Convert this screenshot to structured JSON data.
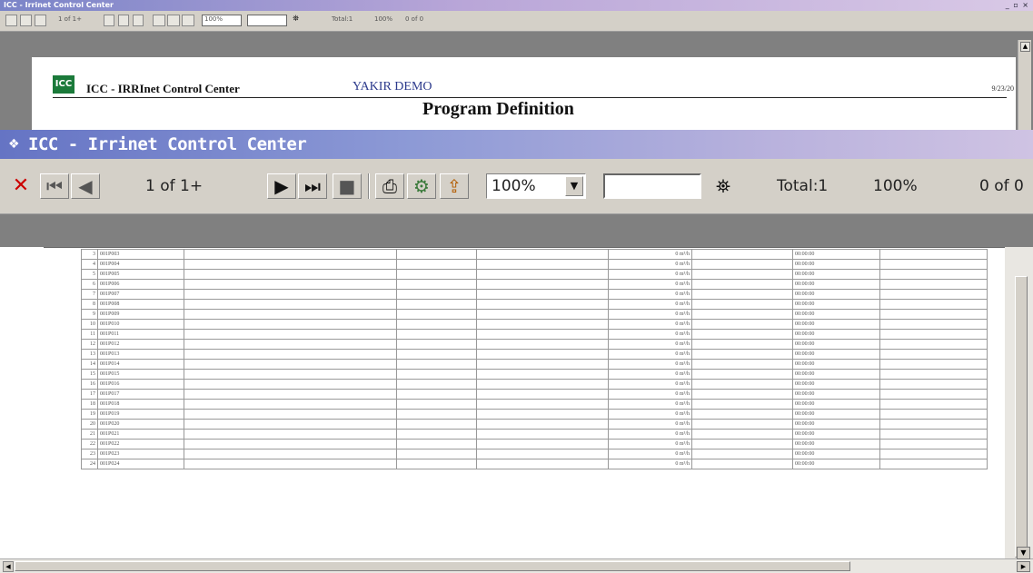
{
  "background_window": {
    "title": "ICC - Irrinet Control Center",
    "window_buttons": "_ ▫ ×",
    "toolbar": {
      "page_indicator": "1 of 1+",
      "zoom": "100%",
      "total": "Total:1",
      "percent": "100%",
      "found": "0 of 0"
    },
    "report": {
      "logo": "ICC",
      "app_title": "ICC - IRRInet Control Center",
      "customer": "YAKIR DEMO",
      "date": "9/23/20",
      "title": "Program Definition"
    }
  },
  "window": {
    "title": "ICC - Irrinet Control Center"
  },
  "toolbar": {
    "page_indicator": "1 of 1+",
    "zoom": "100%",
    "search_value": "",
    "total": "Total:1",
    "percent": "100%",
    "found": "0 of 0",
    "icons": [
      "close-icon",
      "first-page-icon",
      "prev-page-icon",
      "next-page-icon",
      "last-page-icon",
      "stop-icon",
      "print-icon",
      "printer-setup-icon",
      "export-icon",
      "zoom-dropdown-icon",
      "binoculars-icon"
    ]
  },
  "table": {
    "rows": [
      {
        "num": "3",
        "id": "001P003",
        "rate": "0 m³/h",
        "time": "00:00:00"
      },
      {
        "num": "4",
        "id": "001P004",
        "rate": "0 m³/h",
        "time": "00:00:00"
      },
      {
        "num": "5",
        "id": "001P005",
        "rate": "0 m³/h",
        "time": "00:00:00"
      },
      {
        "num": "6",
        "id": "001P006",
        "rate": "0 m³/h",
        "time": "00:00:00"
      },
      {
        "num": "7",
        "id": "001P007",
        "rate": "0 m³/h",
        "time": "00:00:00"
      },
      {
        "num": "8",
        "id": "001P008",
        "rate": "0 m³/h",
        "time": "00:00:00"
      },
      {
        "num": "9",
        "id": "001P009",
        "rate": "0 m³/h",
        "time": "00:00:00"
      },
      {
        "num": "10",
        "id": "001P010",
        "rate": "0 m³/h",
        "time": "00:00:00"
      },
      {
        "num": "11",
        "id": "001P011",
        "rate": "0 m³/h",
        "time": "00:00:00"
      },
      {
        "num": "12",
        "id": "001P012",
        "rate": "0 m³/h",
        "time": "00:00:00"
      },
      {
        "num": "13",
        "id": "001P013",
        "rate": "0 m³/h",
        "time": "00:00:00"
      },
      {
        "num": "14",
        "id": "001P014",
        "rate": "0 m³/h",
        "time": "00:00:00"
      },
      {
        "num": "15",
        "id": "001P015",
        "rate": "0 m³/h",
        "time": "00:00:00"
      },
      {
        "num": "16",
        "id": "001P016",
        "rate": "0 m³/h",
        "time": "00:00:00"
      },
      {
        "num": "17",
        "id": "001P017",
        "rate": "0 m³/h",
        "time": "00:00:00"
      },
      {
        "num": "18",
        "id": "001P018",
        "rate": "0 m³/h",
        "time": "00:00:00"
      },
      {
        "num": "19",
        "id": "001P019",
        "rate": "0 m³/h",
        "time": "00:00:00"
      },
      {
        "num": "20",
        "id": "001P020",
        "rate": "0 m³/h",
        "time": "00:00:00"
      },
      {
        "num": "21",
        "id": "001P021",
        "rate": "0 m³/h",
        "time": "00:00:00"
      },
      {
        "num": "22",
        "id": "001P022",
        "rate": "0 m³/h",
        "time": "00:00:00"
      },
      {
        "num": "23",
        "id": "001P023",
        "rate": "0 m³/h",
        "time": "00:00:00"
      },
      {
        "num": "24",
        "id": "001P024",
        "rate": "0 m³/h",
        "time": "00:00:00"
      }
    ]
  },
  "colors": {
    "title_gradient_start": "#6574c4",
    "title_gradient_end": "#cfc3e3",
    "toolbar_face": "#d4d0c8",
    "workspace_gray": "#808080",
    "close_red": "#cc0000",
    "logo_green": "#1b7a3a",
    "customer_blue": "#2c3a8c"
  }
}
